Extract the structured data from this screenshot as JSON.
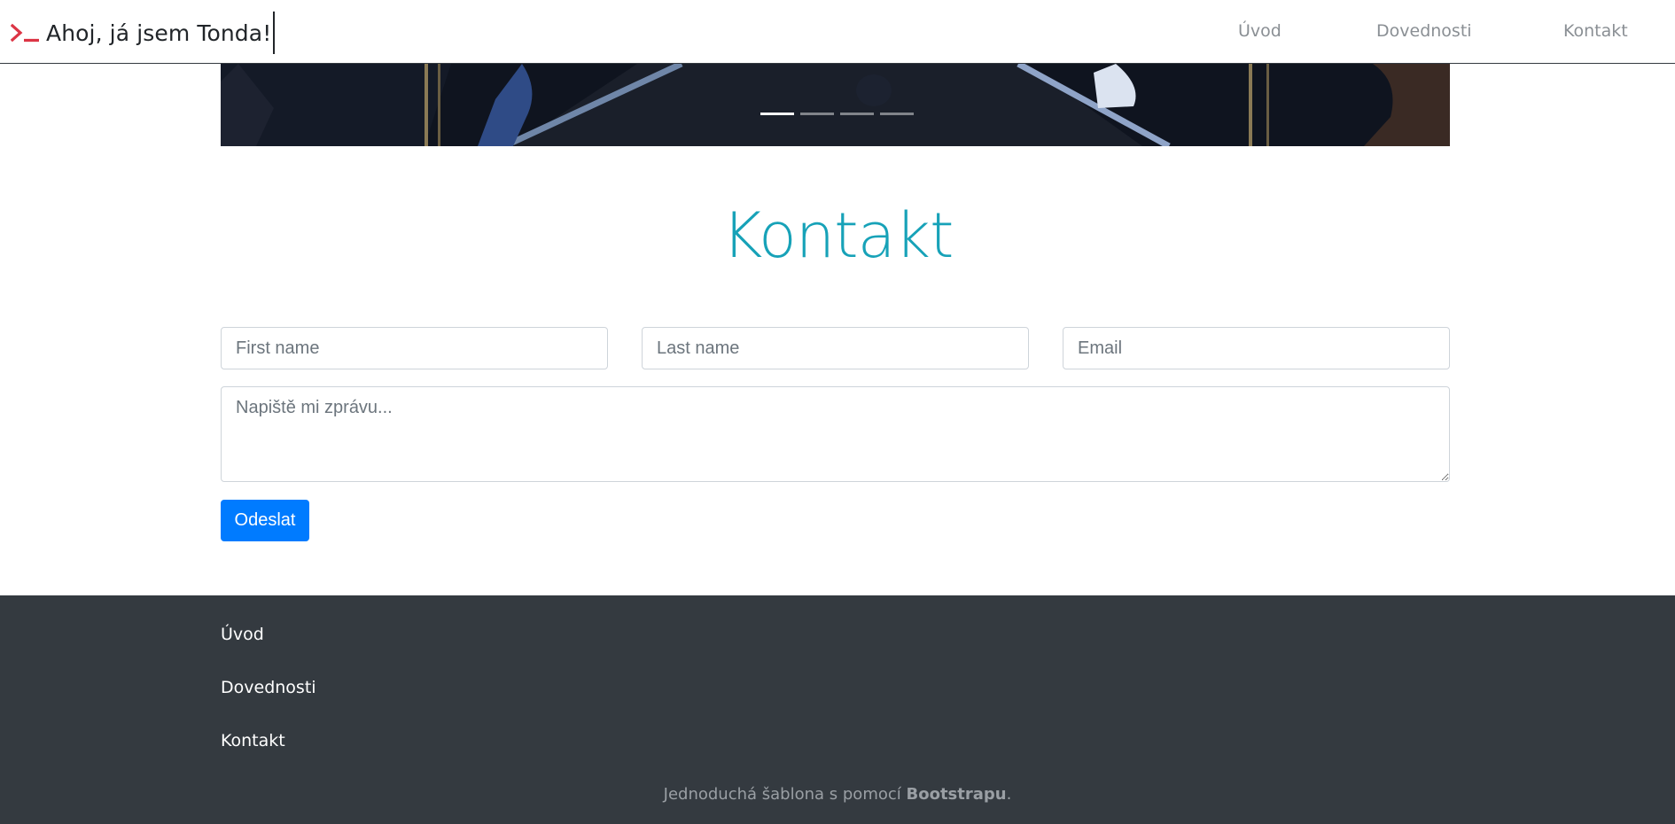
{
  "navbar": {
    "brand_text": "Ahoj, já jsem Tonda!",
    "brand_icon": "terminal-prompt-icon",
    "brand_color": "#dc3545",
    "links": [
      {
        "label": "Úvod"
      },
      {
        "label": "Dovednosti"
      },
      {
        "label": "Kontakt"
      }
    ]
  },
  "carousel": {
    "slide_count": 4,
    "active_index": 0
  },
  "contact": {
    "title": "Kontakt",
    "title_color": "#17a2b8",
    "first_name_placeholder": "First name",
    "last_name_placeholder": "Last name",
    "email_placeholder": "Email",
    "message_placeholder": "Napiště mi zprávu...",
    "submit_label": "Odeslat",
    "submit_color": "#007bff"
  },
  "footer": {
    "background": "#343a40",
    "links": [
      {
        "label": "Úvod"
      },
      {
        "label": "Dovednosti"
      },
      {
        "label": "Kontakt"
      }
    ],
    "note_prefix": "Jednoduchá šablona s pomocí ",
    "note_strong": "Bootstrapu",
    "note_suffix": "."
  }
}
